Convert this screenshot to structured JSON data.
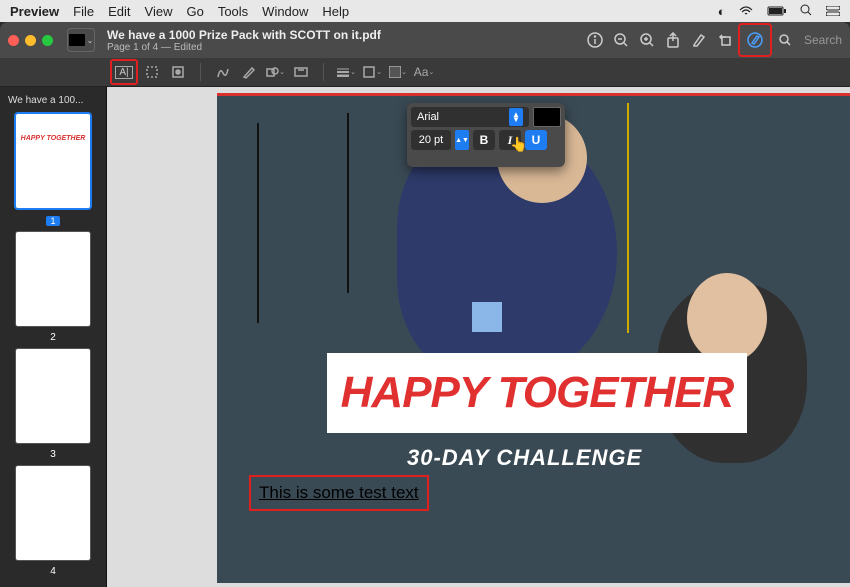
{
  "menubar": {
    "app": "Preview",
    "items": [
      "File",
      "Edit",
      "View",
      "Go",
      "Tools",
      "Window",
      "Help"
    ]
  },
  "titlebar": {
    "doc_title": "We have a 1000 Prize Pack with SCOTT on it.pdf",
    "subtitle": "Page 1 of 4 — Edited",
    "search_placeholder": "Search"
  },
  "sidebar": {
    "section_title": "We have a 100...",
    "pages": [
      {
        "num": "1",
        "selected": true
      },
      {
        "num": "2",
        "selected": false
      },
      {
        "num": "3",
        "selected": false
      },
      {
        "num": "4",
        "selected": false
      }
    ]
  },
  "document": {
    "headline": "HAPPY TOGETHER",
    "subline": "30-DAY CHALLENGE",
    "test_text": "This is some test text"
  },
  "font_panel": {
    "family": "Arial",
    "size": "20 pt",
    "bold_label": "B",
    "italic_label": "I",
    "underline_label": "U",
    "underline_active": true
  },
  "markup_toolbar": {
    "aa_label": "Aa"
  }
}
